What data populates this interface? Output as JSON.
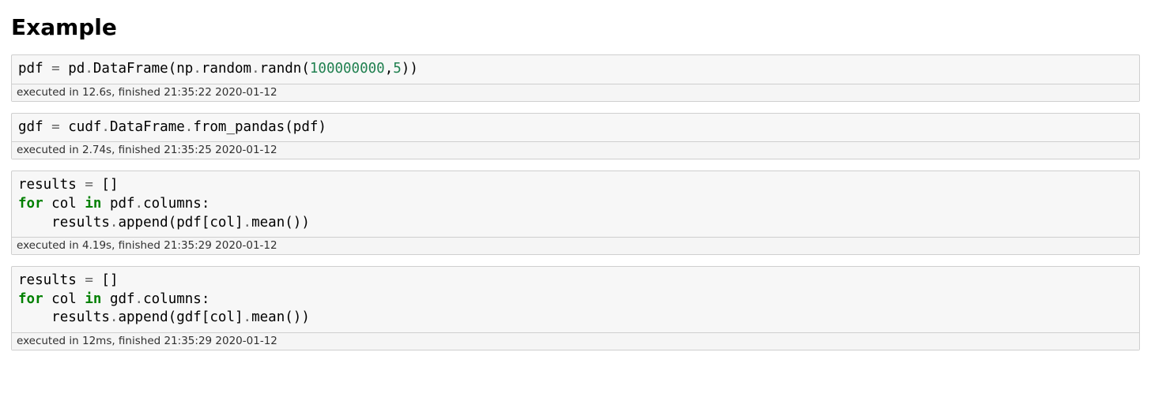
{
  "heading": "Example",
  "cells": [
    {
      "tokens": [
        [
          "name",
          "pdf"
        ],
        [
          "sp",
          " "
        ],
        [
          "op",
          "="
        ],
        [
          "sp",
          " "
        ],
        [
          "name",
          "pd"
        ],
        [
          "op",
          "."
        ],
        [
          "name",
          "DataFrame"
        ],
        [
          "punc",
          "("
        ],
        [
          "name",
          "np"
        ],
        [
          "op",
          "."
        ],
        [
          "name",
          "random"
        ],
        [
          "op",
          "."
        ],
        [
          "name",
          "randn"
        ],
        [
          "punc",
          "("
        ],
        [
          "num",
          "100000000"
        ],
        [
          "punc",
          ","
        ],
        [
          "num",
          "5"
        ],
        [
          "punc",
          ")"
        ],
        [
          "punc",
          ")"
        ]
      ],
      "exec": "executed in 12.6s, finished 21:35:22 2020-01-12"
    },
    {
      "tokens": [
        [
          "name",
          "gdf"
        ],
        [
          "sp",
          " "
        ],
        [
          "op",
          "="
        ],
        [
          "sp",
          " "
        ],
        [
          "name",
          "cudf"
        ],
        [
          "op",
          "."
        ],
        [
          "name",
          "DataFrame"
        ],
        [
          "op",
          "."
        ],
        [
          "name",
          "from_pandas"
        ],
        [
          "punc",
          "("
        ],
        [
          "name",
          "pdf"
        ],
        [
          "punc",
          ")"
        ]
      ],
      "exec": "executed in 2.74s, finished 21:35:25 2020-01-12"
    },
    {
      "tokens": [
        [
          "name",
          "results"
        ],
        [
          "sp",
          " "
        ],
        [
          "op",
          "="
        ],
        [
          "sp",
          " "
        ],
        [
          "punc",
          "["
        ],
        [
          "punc",
          "]"
        ],
        [
          "nl",
          "\n"
        ],
        [
          "kw",
          "for"
        ],
        [
          "sp",
          " "
        ],
        [
          "name",
          "col"
        ],
        [
          "sp",
          " "
        ],
        [
          "kw",
          "in"
        ],
        [
          "sp",
          " "
        ],
        [
          "name",
          "pdf"
        ],
        [
          "op",
          "."
        ],
        [
          "name",
          "columns"
        ],
        [
          "punc",
          ":"
        ],
        [
          "nl",
          "\n"
        ],
        [
          "sp",
          "    "
        ],
        [
          "name",
          "results"
        ],
        [
          "op",
          "."
        ],
        [
          "name",
          "append"
        ],
        [
          "punc",
          "("
        ],
        [
          "name",
          "pdf"
        ],
        [
          "punc",
          "["
        ],
        [
          "name",
          "col"
        ],
        [
          "punc",
          "]"
        ],
        [
          "op",
          "."
        ],
        [
          "name",
          "mean"
        ],
        [
          "punc",
          "("
        ],
        [
          "punc",
          ")"
        ],
        [
          "punc",
          ")"
        ]
      ],
      "exec": "executed in 4.19s, finished 21:35:29 2020-01-12"
    },
    {
      "tokens": [
        [
          "name",
          "results"
        ],
        [
          "sp",
          " "
        ],
        [
          "op",
          "="
        ],
        [
          "sp",
          " "
        ],
        [
          "punc",
          "["
        ],
        [
          "punc",
          "]"
        ],
        [
          "nl",
          "\n"
        ],
        [
          "kw",
          "for"
        ],
        [
          "sp",
          " "
        ],
        [
          "name",
          "col"
        ],
        [
          "sp",
          " "
        ],
        [
          "kw",
          "in"
        ],
        [
          "sp",
          " "
        ],
        [
          "name",
          "gdf"
        ],
        [
          "op",
          "."
        ],
        [
          "name",
          "columns"
        ],
        [
          "punc",
          ":"
        ],
        [
          "nl",
          "\n"
        ],
        [
          "sp",
          "    "
        ],
        [
          "name",
          "results"
        ],
        [
          "op",
          "."
        ],
        [
          "name",
          "append"
        ],
        [
          "punc",
          "("
        ],
        [
          "name",
          "gdf"
        ],
        [
          "punc",
          "["
        ],
        [
          "name",
          "col"
        ],
        [
          "punc",
          "]"
        ],
        [
          "op",
          "."
        ],
        [
          "name",
          "mean"
        ],
        [
          "punc",
          "("
        ],
        [
          "punc",
          ")"
        ],
        [
          "punc",
          ")"
        ]
      ],
      "exec": "executed in 12ms, finished 21:35:29 2020-01-12"
    }
  ]
}
